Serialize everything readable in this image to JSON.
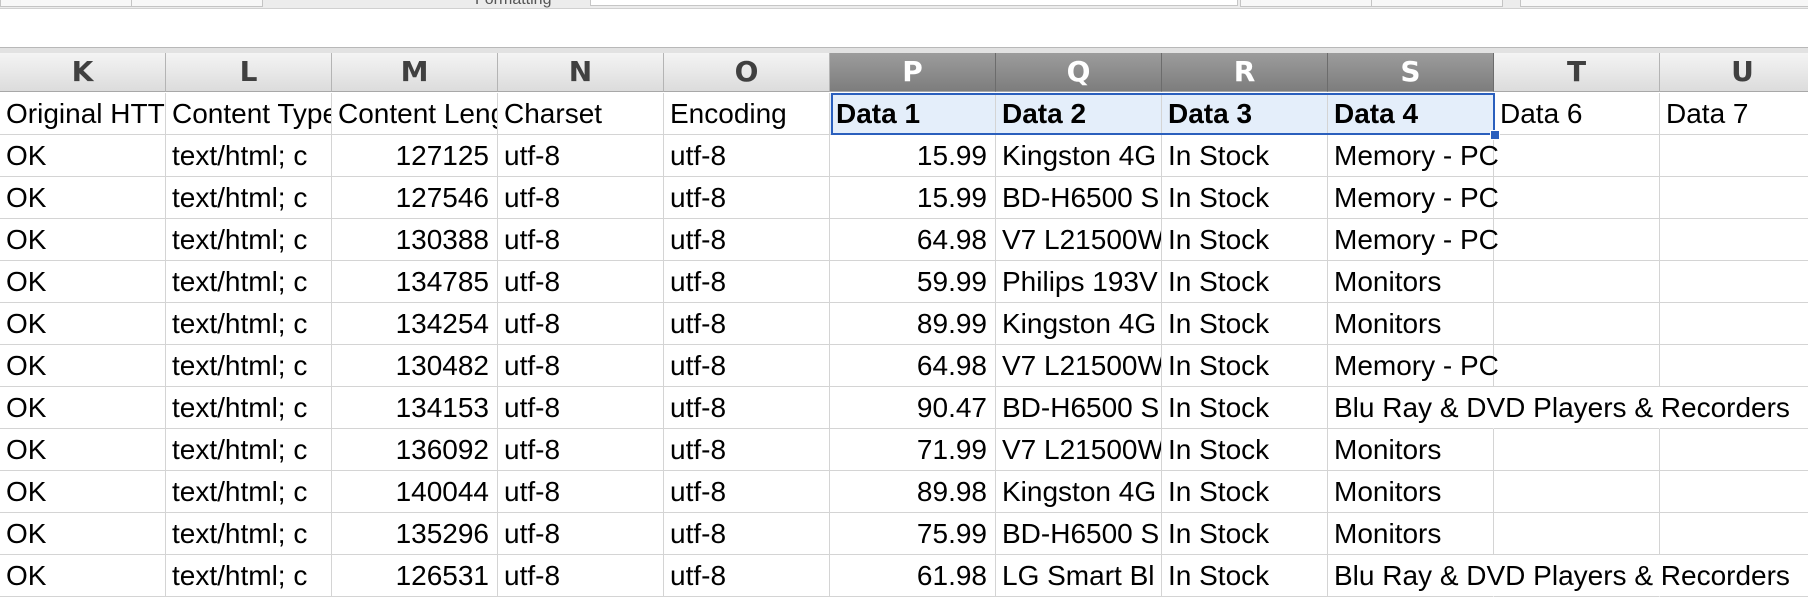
{
  "toolbar": {
    "formatting_label": "Formatting"
  },
  "columns": [
    "K",
    "L",
    "M",
    "N",
    "O",
    "P",
    "Q",
    "R",
    "S",
    "T",
    "U"
  ],
  "selected_columns": [
    "P",
    "Q",
    "R",
    "S"
  ],
  "header_row": [
    "Original HTTP",
    "Content Type",
    "Content Length",
    "Charset",
    "Encoding",
    "Data 1",
    "Data 2",
    "Data 3",
    "Data 4",
    "Data 6",
    "Data 7"
  ],
  "rows": [
    [
      "OK",
      "text/html; c",
      "127125",
      "utf-8",
      "utf-8",
      "15.99",
      "Kingston 4G",
      "In Stock",
      "Memory - PC",
      "",
      ""
    ],
    [
      "OK",
      "text/html; c",
      "127546",
      "utf-8",
      "utf-8",
      "15.99",
      "BD-H6500 S",
      "In Stock",
      "Memory - PC",
      "",
      ""
    ],
    [
      "OK",
      "text/html; c",
      "130388",
      "utf-8",
      "utf-8",
      "64.98",
      "V7 L21500W",
      "In Stock",
      "Memory - PC",
      "",
      ""
    ],
    [
      "OK",
      "text/html; c",
      "134785",
      "utf-8",
      "utf-8",
      "59.99",
      "Philips 193V",
      "In Stock",
      "Monitors",
      "",
      ""
    ],
    [
      "OK",
      "text/html; c",
      "134254",
      "utf-8",
      "utf-8",
      "89.99",
      "Kingston 4G",
      "In Stock",
      "Monitors",
      "",
      ""
    ],
    [
      "OK",
      "text/html; c",
      "130482",
      "utf-8",
      "utf-8",
      "64.98",
      "V7 L21500W",
      "In Stock",
      "Memory - PC",
      "",
      ""
    ],
    [
      "OK",
      "text/html; c",
      "134153",
      "utf-8",
      "utf-8",
      "90.47",
      "BD-H6500 S",
      "In Stock",
      "Blu Ray & DVD Players & Recorders",
      "",
      ""
    ],
    [
      "OK",
      "text/html; c",
      "136092",
      "utf-8",
      "utf-8",
      "71.99",
      "V7 L21500W",
      "In Stock",
      "Monitors",
      "",
      ""
    ],
    [
      "OK",
      "text/html; c",
      "140044",
      "utf-8",
      "utf-8",
      "89.98",
      "Kingston 4G",
      "In Stock",
      "Monitors",
      "",
      ""
    ],
    [
      "OK",
      "text/html; c",
      "135296",
      "utf-8",
      "utf-8",
      "75.99",
      "BD-H6500 S",
      "In Stock",
      "Monitors",
      "",
      ""
    ],
    [
      "OK",
      "text/html; c",
      "126531",
      "utf-8",
      "utf-8",
      "61.98",
      "LG Smart Bl",
      "In Stock",
      "Blu Ray & DVD Players & Recorders",
      "",
      ""
    ]
  ]
}
